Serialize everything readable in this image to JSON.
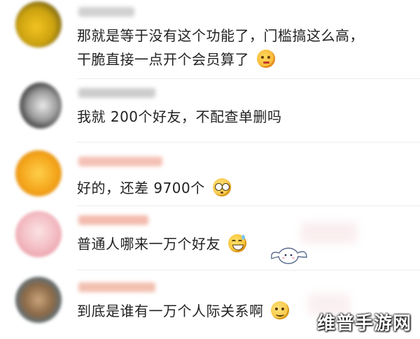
{
  "comments": [
    {
      "line1": "那就是等于没有这个功能了，门槛搞这么高，",
      "line2": "干脆直接一点开个会员算了",
      "emoji": "thinking-face-emoji"
    },
    {
      "line1": "我就 200个好友，不配查单删吗"
    },
    {
      "line1": "好的，还差 9700个",
      "emoji": "dizzy-eyes-emoji"
    },
    {
      "line1": "普通人哪来一万个好友",
      "emoji": "grinning-sweat-emoji",
      "sticker": "cinnamoroll-sticker"
    },
    {
      "line1": "到底是谁有一万个人际关系啊",
      "emoji": "smiling-face-emoji"
    }
  ],
  "watermark": "维普手游网",
  "colors": {
    "text": "#222222",
    "divider": "#ededed",
    "emoji_yellow": "#f7c52d"
  }
}
